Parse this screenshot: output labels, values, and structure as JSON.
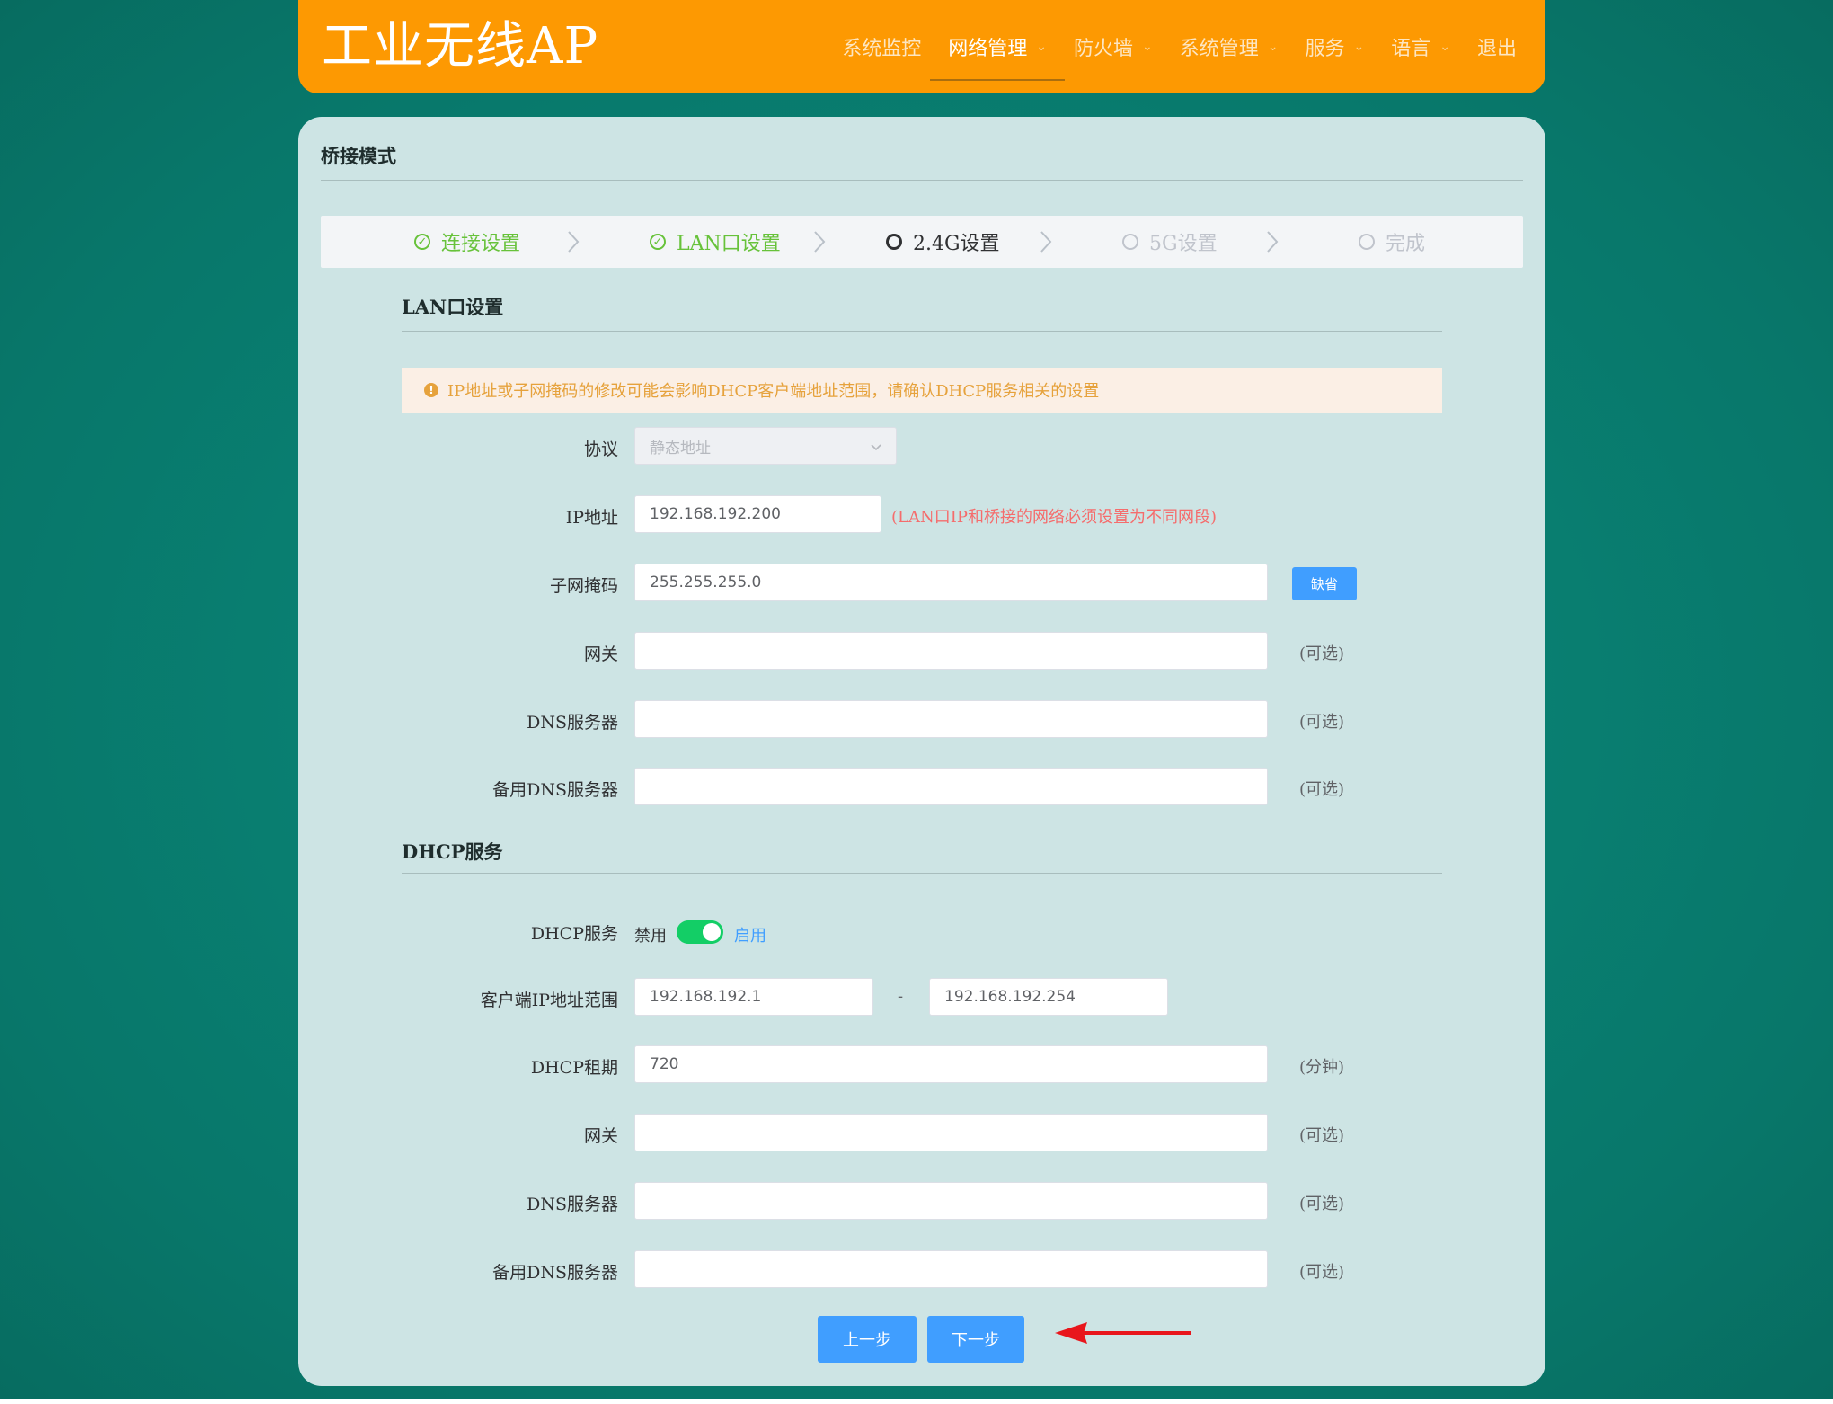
{
  "header": {
    "brand": "工业无线AP",
    "nav": [
      {
        "label": "系统监控",
        "has_caret": false,
        "active": false
      },
      {
        "label": "网络管理",
        "has_caret": true,
        "active": true
      },
      {
        "label": "防火墙",
        "has_caret": true,
        "active": false
      },
      {
        "label": "系统管理",
        "has_caret": true,
        "active": false
      },
      {
        "label": "服务",
        "has_caret": true,
        "active": false
      },
      {
        "label": "语言",
        "has_caret": true,
        "active": false
      },
      {
        "label": "退出",
        "has_caret": false,
        "active": false
      }
    ],
    "caret_glyph": "⌄"
  },
  "card": {
    "title": "桥接模式"
  },
  "steps": [
    {
      "label": "连接设置",
      "state": "done",
      "icon": "check-circle-icon"
    },
    {
      "label": "LAN口设置",
      "state": "done",
      "icon": "check-circle-icon"
    },
    {
      "label": "2.4G设置",
      "state": "current",
      "icon": "circle-icon"
    },
    {
      "label": "5G设置",
      "state": "todo",
      "icon": "circle-icon"
    },
    {
      "label": "完成",
      "state": "todo",
      "icon": "circle-icon"
    }
  ],
  "lan": {
    "title": "LAN口设置",
    "alert": "IP地址或子网掩码的修改可能会影响DHCP客户端地址范围，请确认DHCP服务相关的设置",
    "alert_icon": "!",
    "protocol_label": "协议",
    "protocol_value": "静态地址",
    "ip_label": "IP地址",
    "ip_value": "192.168.192.200",
    "ip_hint": "(LAN口IP和桥接的网络必须设置为不同网段)",
    "mask_label": "子网掩码",
    "mask_value": "255.255.255.0",
    "default_button": "缺省",
    "gateway_label": "网关",
    "gateway_value": "",
    "dns_label": "DNS服务器",
    "dns_value": "",
    "dns2_label": "备用DNS服务器",
    "dns2_value": "",
    "optional": "(可选)"
  },
  "dhcp": {
    "title": "DHCP服务",
    "service_label": "DHCP服务",
    "off_label": "禁用",
    "on_label": "启用",
    "enabled": true,
    "range_label": "客户端IP地址范围",
    "range_start": "192.168.192.1",
    "range_sep": "-",
    "range_end": "192.168.192.254",
    "lease_label": "DHCP租期",
    "lease_value": "720",
    "lease_unit": "(分钟)",
    "gateway_label": "网关",
    "gateway_value": "",
    "dns_label": "DNS服务器",
    "dns_value": "",
    "dns2_label": "备用DNS服务器",
    "dns2_value": "",
    "optional": "(可选)"
  },
  "buttons": {
    "prev": "上一步",
    "next": "下一步"
  },
  "colors": {
    "header": "#fd9902",
    "background": "#08776a",
    "card": "#cde4e4",
    "primary": "#409eff",
    "success": "#67c23a",
    "switch_on": "#13ce66",
    "warning": "#e6a23c",
    "danger": "#f56c6c",
    "annotation_arrow": "#e8161c"
  }
}
